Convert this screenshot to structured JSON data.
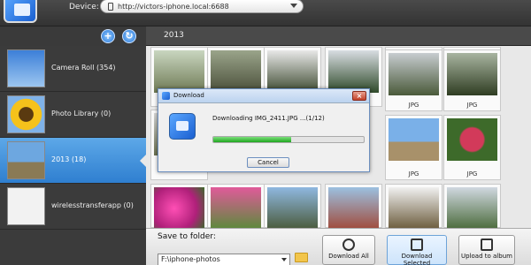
{
  "header": {
    "device_label": "Device:",
    "device_url": "http://victors-iphone.local:6688"
  },
  "albums": [
    {
      "label": "Camera Roll (354)",
      "selected": false
    },
    {
      "label": "Photo Library (0)",
      "selected": false
    },
    {
      "label": "2013 (18)",
      "selected": true
    },
    {
      "label": "wirelesstransferapp (0)",
      "selected": false
    }
  ],
  "main": {
    "year": "2013"
  },
  "photos": [
    {
      "caption": ""
    },
    {
      "caption": ""
    },
    {
      "caption": ""
    },
    {
      "caption": ""
    },
    {
      "caption": ""
    },
    {
      "caption": ""
    },
    {
      "caption": "JPG"
    },
    {
      "caption": "JPG"
    },
    {
      "caption": "JPG"
    },
    {
      "caption": "JPG"
    },
    {
      "caption": ""
    },
    {
      "caption": ""
    },
    {
      "caption": ""
    },
    {
      "caption": ""
    },
    {
      "caption": ""
    },
    {
      "caption": ""
    }
  ],
  "bottom": {
    "save_label": "Save to folder:",
    "folder_path": "F:\\iphone-photos",
    "download_all": "Download All",
    "download_selected": "Download Selected",
    "upload": "Upload to album"
  },
  "dialog": {
    "title": "Download",
    "message": "Downloading IMG_2411.JPG ...(1/12)",
    "progress": 0.52,
    "cancel": "Cancel"
  }
}
